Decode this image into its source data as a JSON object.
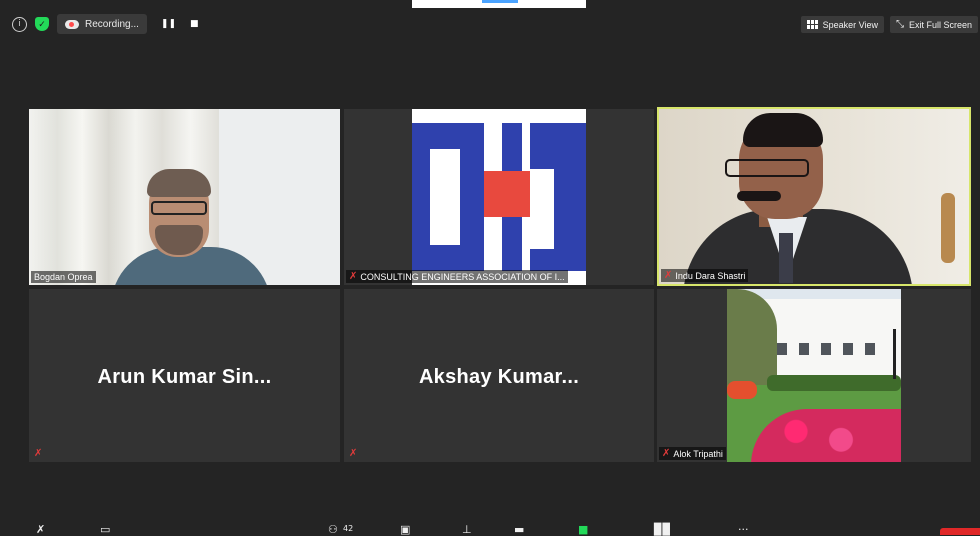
{
  "topbar": {
    "info_icon": "info-icon",
    "shield_icon": "shield-icon",
    "recording_label": "Recording...",
    "pause_glyph": "❚❚",
    "stop_glyph": "■",
    "speaker_view_label": "Speaker View",
    "exit_fullscreen_label": "Exit Full Screen"
  },
  "participants": [
    {
      "name": "Bogdan Oprea",
      "video": true,
      "muted": false
    },
    {
      "name": "CONSULTING ENGINEERS ASSOCIATION OF I...",
      "video": true,
      "muted": true
    },
    {
      "name": "Indu Dara Shastri",
      "video": true,
      "muted": true,
      "active_speaker": true
    },
    {
      "name": "Arun Kumar Sin...",
      "video": false,
      "muted": true
    },
    {
      "name": "Akshay Kumar...",
      "video": false,
      "muted": true
    },
    {
      "name": "Alok Tripathi",
      "video": true,
      "muted": true
    }
  ],
  "bottombar": {
    "participants_count": "42",
    "mute_glyph": "✗",
    "more_glyph": "···"
  },
  "colors": {
    "background": "#242424",
    "tile": "#333333",
    "active_border": "#d8e66b",
    "muted_icon": "#e23b3b",
    "end_button": "#e02828"
  }
}
